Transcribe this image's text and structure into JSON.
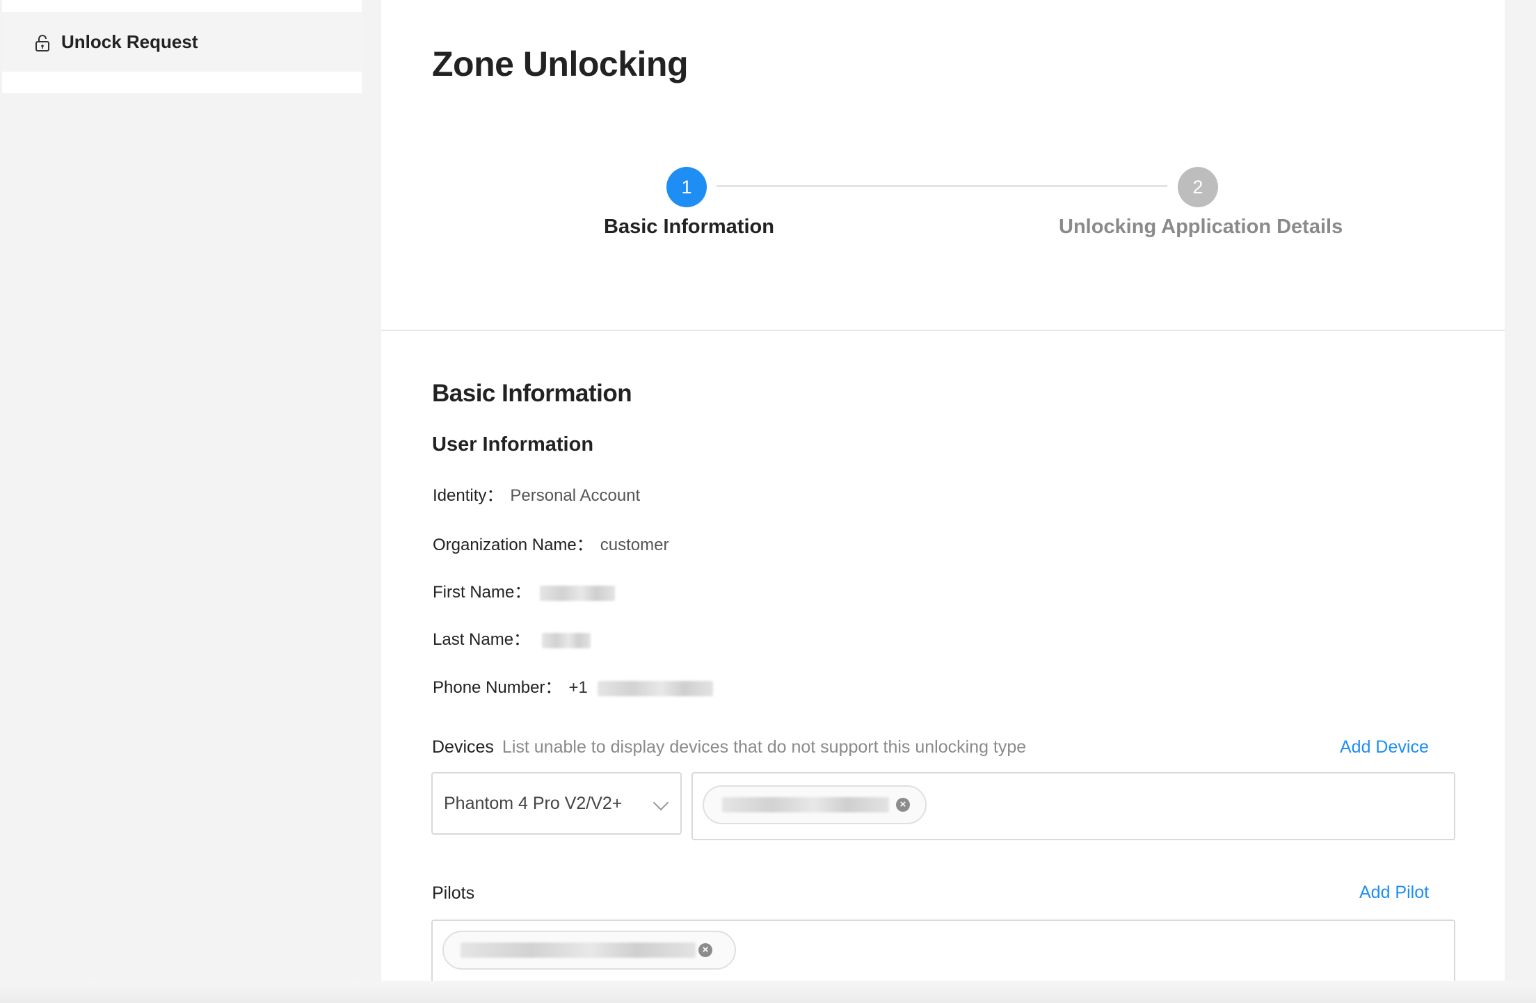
{
  "sidebar": {
    "items": [
      {
        "label": "Unlock Request",
        "icon": "lock-icon"
      }
    ]
  },
  "main": {
    "title": "Zone Unlocking",
    "steps": [
      {
        "number": "1",
        "label": "Basic Information",
        "state": "active"
      },
      {
        "number": "2",
        "label": "Unlocking Application Details",
        "state": "inactive"
      }
    ],
    "section_title": "Basic Information",
    "user_info_title": "User Information",
    "fields": {
      "identity_label": "Identity：",
      "identity_value": "Personal Account",
      "org_label": "Organization Name：",
      "org_value": "customer",
      "first_name_label": "First Name：",
      "last_name_label": "Last Name：",
      "phone_label": "Phone Number：",
      "phone_prefix": "+1"
    },
    "devices": {
      "label": "Devices",
      "hint": "List unable to display devices that do not support this unlocking type",
      "add_label": "Add Device",
      "selected_model": "Phantom 4 Pro V2/V2+"
    },
    "pilots": {
      "label": "Pilots",
      "add_label": "Add Pilot"
    }
  },
  "colors": {
    "accent": "#1e8ef5",
    "inactive_step": "#bdbdbd",
    "background": "#f3f3f3"
  }
}
